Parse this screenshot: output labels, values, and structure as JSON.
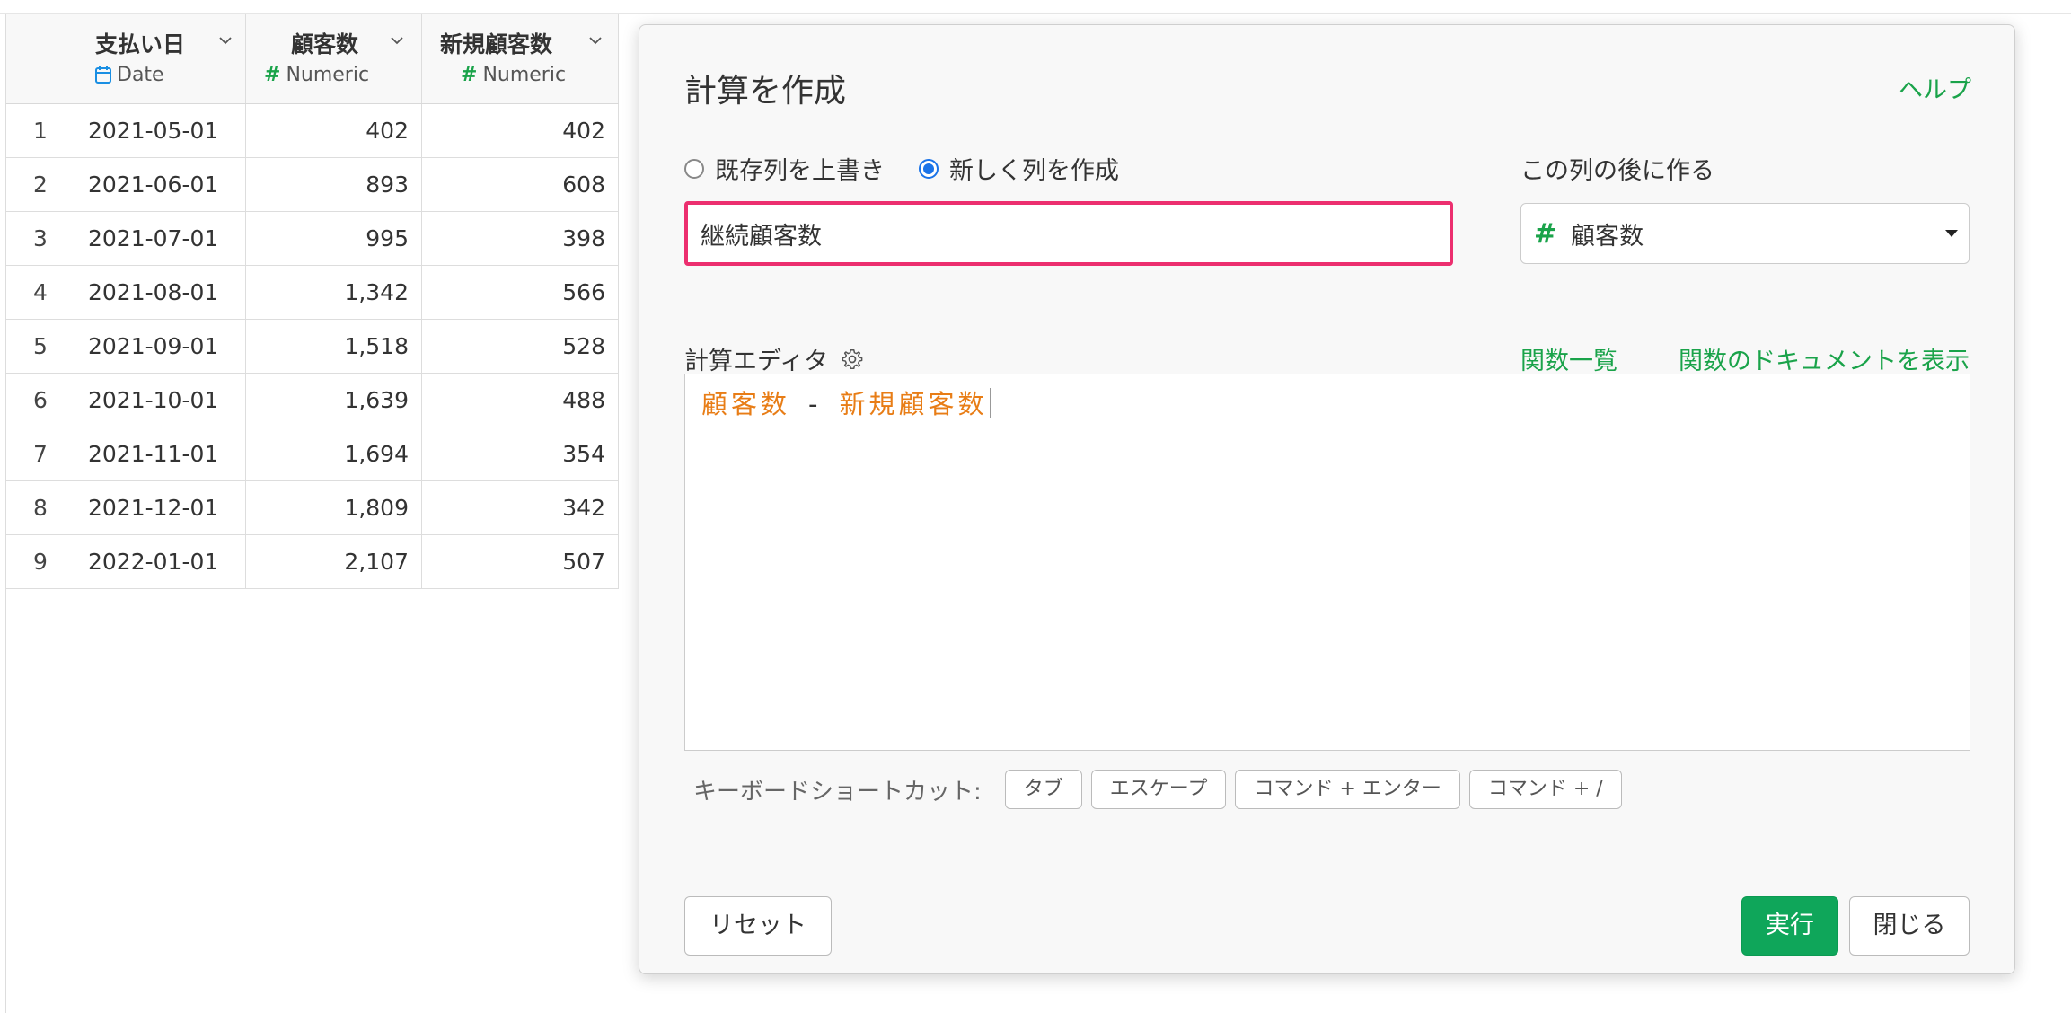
{
  "grid": {
    "columns": [
      {
        "name": "支払い日",
        "type": "Date",
        "type_icon": "calendar-icon"
      },
      {
        "name": "顧客数",
        "type": "Numeric",
        "type_icon": "hash-icon"
      },
      {
        "name": "新規顧客数",
        "type": "Numeric",
        "type_icon": "hash-icon"
      }
    ],
    "rows": [
      [
        "1",
        "2021-05-01",
        "402",
        "402"
      ],
      [
        "2",
        "2021-06-01",
        "893",
        "608"
      ],
      [
        "3",
        "2021-07-01",
        "995",
        "398"
      ],
      [
        "4",
        "2021-08-01",
        "1,342",
        "566"
      ],
      [
        "5",
        "2021-09-01",
        "1,518",
        "528"
      ],
      [
        "6",
        "2021-10-01",
        "1,639",
        "488"
      ],
      [
        "7",
        "2021-11-01",
        "1,694",
        "354"
      ],
      [
        "8",
        "2021-12-01",
        "1,809",
        "342"
      ],
      [
        "9",
        "2022-01-01",
        "2,107",
        "507"
      ]
    ]
  },
  "dialog": {
    "title": "計算を作成",
    "help": "ヘルプ",
    "radio_overwrite": "既存列を上書き",
    "radio_new": "新しく列を作成",
    "selected_mode": "new",
    "new_column_name": "継続顧客数",
    "after_label": "この列の後に作る",
    "after_column": "顧客数",
    "editor_label": "計算エディタ",
    "func_list": "関数一覧",
    "func_docs": "関数のドキュメントを表示",
    "formula": {
      "left": "顧客数",
      "operator": "-",
      "right": "新規顧客数"
    },
    "shortcuts_label": "キーボードショートカット:",
    "shortcuts": [
      "タブ",
      "エスケープ",
      "コマンド + エンター",
      "コマンド + /"
    ],
    "reset": "リセット",
    "run": "実行",
    "close": "閉じる"
  },
  "colors": {
    "accent_green": "#1aa34a",
    "run_button": "#0fa65a",
    "input_highlight": "#ec2f6f",
    "formula_field": "#e87d16",
    "radio_selected": "#1a73e8"
  }
}
